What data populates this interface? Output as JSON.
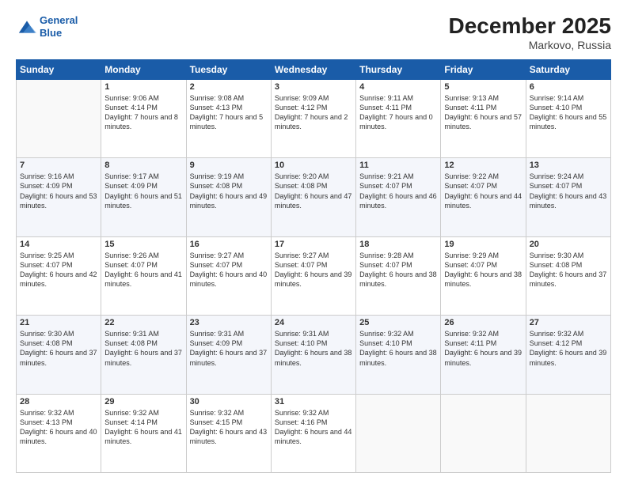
{
  "header": {
    "logo_line1": "General",
    "logo_line2": "Blue",
    "title": "December 2025",
    "subtitle": "Markovo, Russia"
  },
  "days_of_week": [
    "Sunday",
    "Monday",
    "Tuesday",
    "Wednesday",
    "Thursday",
    "Friday",
    "Saturday"
  ],
  "weeks": [
    [
      {
        "day": "",
        "sunrise": "",
        "sunset": "",
        "daylight": ""
      },
      {
        "day": "1",
        "sunrise": "9:06 AM",
        "sunset": "4:14 PM",
        "daylight": "7 hours and 8 minutes."
      },
      {
        "day": "2",
        "sunrise": "9:08 AM",
        "sunset": "4:13 PM",
        "daylight": "7 hours and 5 minutes."
      },
      {
        "day": "3",
        "sunrise": "9:09 AM",
        "sunset": "4:12 PM",
        "daylight": "7 hours and 2 minutes."
      },
      {
        "day": "4",
        "sunrise": "9:11 AM",
        "sunset": "4:11 PM",
        "daylight": "7 hours and 0 minutes."
      },
      {
        "day": "5",
        "sunrise": "9:13 AM",
        "sunset": "4:11 PM",
        "daylight": "6 hours and 57 minutes."
      },
      {
        "day": "6",
        "sunrise": "9:14 AM",
        "sunset": "4:10 PM",
        "daylight": "6 hours and 55 minutes."
      }
    ],
    [
      {
        "day": "7",
        "sunrise": "9:16 AM",
        "sunset": "4:09 PM",
        "daylight": "6 hours and 53 minutes."
      },
      {
        "day": "8",
        "sunrise": "9:17 AM",
        "sunset": "4:09 PM",
        "daylight": "6 hours and 51 minutes."
      },
      {
        "day": "9",
        "sunrise": "9:19 AM",
        "sunset": "4:08 PM",
        "daylight": "6 hours and 49 minutes."
      },
      {
        "day": "10",
        "sunrise": "9:20 AM",
        "sunset": "4:08 PM",
        "daylight": "6 hours and 47 minutes."
      },
      {
        "day": "11",
        "sunrise": "9:21 AM",
        "sunset": "4:07 PM",
        "daylight": "6 hours and 46 minutes."
      },
      {
        "day": "12",
        "sunrise": "9:22 AM",
        "sunset": "4:07 PM",
        "daylight": "6 hours and 44 minutes."
      },
      {
        "day": "13",
        "sunrise": "9:24 AM",
        "sunset": "4:07 PM",
        "daylight": "6 hours and 43 minutes."
      }
    ],
    [
      {
        "day": "14",
        "sunrise": "9:25 AM",
        "sunset": "4:07 PM",
        "daylight": "6 hours and 42 minutes."
      },
      {
        "day": "15",
        "sunrise": "9:26 AM",
        "sunset": "4:07 PM",
        "daylight": "6 hours and 41 minutes."
      },
      {
        "day": "16",
        "sunrise": "9:27 AM",
        "sunset": "4:07 PM",
        "daylight": "6 hours and 40 minutes."
      },
      {
        "day": "17",
        "sunrise": "9:27 AM",
        "sunset": "4:07 PM",
        "daylight": "6 hours and 39 minutes."
      },
      {
        "day": "18",
        "sunrise": "9:28 AM",
        "sunset": "4:07 PM",
        "daylight": "6 hours and 38 minutes."
      },
      {
        "day": "19",
        "sunrise": "9:29 AM",
        "sunset": "4:07 PM",
        "daylight": "6 hours and 38 minutes."
      },
      {
        "day": "20",
        "sunrise": "9:30 AM",
        "sunset": "4:08 PM",
        "daylight": "6 hours and 37 minutes."
      }
    ],
    [
      {
        "day": "21",
        "sunrise": "9:30 AM",
        "sunset": "4:08 PM",
        "daylight": "6 hours and 37 minutes."
      },
      {
        "day": "22",
        "sunrise": "9:31 AM",
        "sunset": "4:08 PM",
        "daylight": "6 hours and 37 minutes."
      },
      {
        "day": "23",
        "sunrise": "9:31 AM",
        "sunset": "4:09 PM",
        "daylight": "6 hours and 37 minutes."
      },
      {
        "day": "24",
        "sunrise": "9:31 AM",
        "sunset": "4:10 PM",
        "daylight": "6 hours and 38 minutes."
      },
      {
        "day": "25",
        "sunrise": "9:32 AM",
        "sunset": "4:10 PM",
        "daylight": "6 hours and 38 minutes."
      },
      {
        "day": "26",
        "sunrise": "9:32 AM",
        "sunset": "4:11 PM",
        "daylight": "6 hours and 39 minutes."
      },
      {
        "day": "27",
        "sunrise": "9:32 AM",
        "sunset": "4:12 PM",
        "daylight": "6 hours and 39 minutes."
      }
    ],
    [
      {
        "day": "28",
        "sunrise": "9:32 AM",
        "sunset": "4:13 PM",
        "daylight": "6 hours and 40 minutes."
      },
      {
        "day": "29",
        "sunrise": "9:32 AM",
        "sunset": "4:14 PM",
        "daylight": "6 hours and 41 minutes."
      },
      {
        "day": "30",
        "sunrise": "9:32 AM",
        "sunset": "4:15 PM",
        "daylight": "6 hours and 43 minutes."
      },
      {
        "day": "31",
        "sunrise": "9:32 AM",
        "sunset": "4:16 PM",
        "daylight": "6 hours and 44 minutes."
      },
      {
        "day": "",
        "sunrise": "",
        "sunset": "",
        "daylight": ""
      },
      {
        "day": "",
        "sunrise": "",
        "sunset": "",
        "daylight": ""
      },
      {
        "day": "",
        "sunrise": "",
        "sunset": "",
        "daylight": ""
      }
    ]
  ]
}
